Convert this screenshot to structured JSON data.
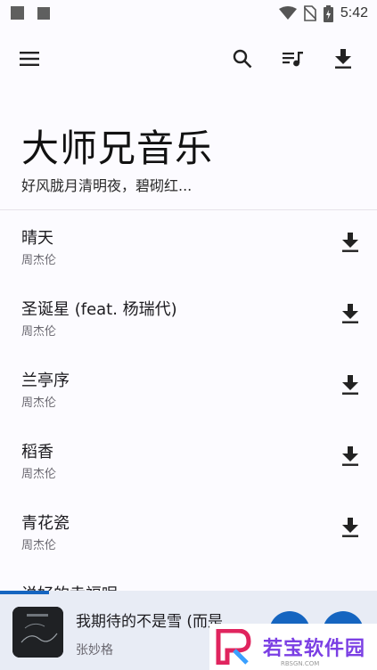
{
  "status_bar": {
    "time": "5:42",
    "icons": [
      "wifi-icon",
      "no-sim-icon",
      "battery-icon"
    ]
  },
  "app_bar": {
    "icons": [
      "menu-icon",
      "search-icon",
      "queue-music-icon",
      "download-icon"
    ]
  },
  "hero": {
    "title": "大师兄音乐",
    "subtitle": "好风胧月清明夜，碧砌红..."
  },
  "songs": [
    {
      "title": "晴天",
      "artist": "周杰伦"
    },
    {
      "title": "圣诞星 (feat. 杨瑞代)",
      "artist": "周杰伦"
    },
    {
      "title": "兰亭序",
      "artist": "周杰伦"
    },
    {
      "title": "稻香",
      "artist": "周杰伦"
    },
    {
      "title": "青花瓷",
      "artist": "周杰伦"
    },
    {
      "title": "说好的幸福呢",
      "artist": ""
    }
  ],
  "player": {
    "title": "我期待的不是雪 (而是...",
    "artist": "张妙格",
    "progress": 0.13
  },
  "watermark": {
    "text": "若宝软件园",
    "url": "RBSGN.COM"
  },
  "colors": {
    "accent": "#1565c0",
    "background": "#fcfbff",
    "player_bg": "#e8ecf5"
  }
}
